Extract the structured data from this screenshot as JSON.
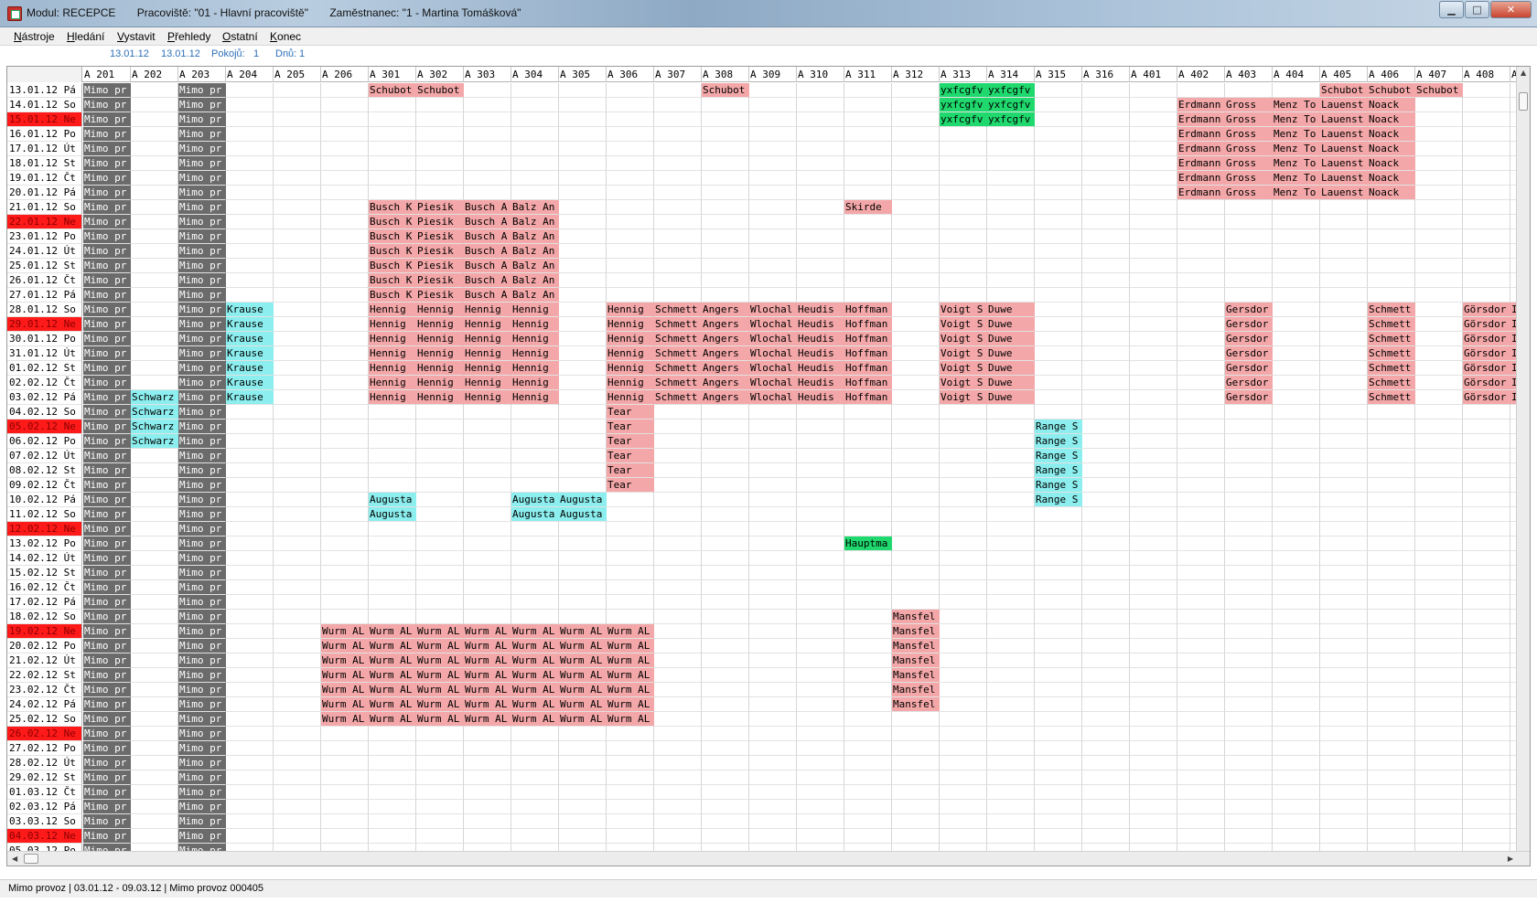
{
  "window": {
    "module": "Modul: RECEPCE",
    "workplace": "Pracoviště: \"01 - Hlavní pracoviště\"",
    "employee": "Zaměstnanec: \"1 - Martina Tomášková\"",
    "min_glyph": "▁",
    "max_glyph": "□",
    "close_glyph": "✕"
  },
  "menu": [
    {
      "hot": "N",
      "rest": "ástroje"
    },
    {
      "hot": "H",
      "rest": "ledání"
    },
    {
      "hot": "V",
      "rest": "ystavit"
    },
    {
      "hot": "P",
      "rest": "řehledy"
    },
    {
      "hot": "O",
      "rest": "statní"
    },
    {
      "hot": "K",
      "rest": "onec"
    }
  ],
  "info": {
    "date_from": "13.01.12",
    "date_to": "13.01.12",
    "rooms_label": "Pokojů:",
    "rooms_value": "1",
    "days_label": "Dnů:",
    "days_value": "1"
  },
  "colors": {
    "out_of_service": "#6b6b6b",
    "reservation": "#f4a7a8",
    "arrival": "#8ceeee",
    "confirmed": "#1fd96e",
    "sunday": "#ff1a1a"
  },
  "rooms": [
    "A 201",
    "A 202",
    "A 203",
    "A 204",
    "A 205",
    "A 206",
    "A 301",
    "A 302",
    "A 303",
    "A 304",
    "A 305",
    "A 306",
    "A 307",
    "A 308",
    "A 309",
    "A 310",
    "A 311",
    "A 312",
    "A 313",
    "A 314",
    "A 315",
    "A 316",
    "A 401",
    "A 402",
    "A 403",
    "A 404",
    "A 405",
    "A 406",
    "A 407",
    "A 408",
    "A "
  ],
  "dates": [
    {
      "label": "13.01.12 Pá"
    },
    {
      "label": "14.01.12 So"
    },
    {
      "label": "15.01.12 Ne",
      "sunday": true
    },
    {
      "label": "16.01.12 Po"
    },
    {
      "label": "17.01.12 Út"
    },
    {
      "label": "18.01.12 St"
    },
    {
      "label": "19.01.12 Čt"
    },
    {
      "label": "20.01.12 Pá"
    },
    {
      "label": "21.01.12 So"
    },
    {
      "label": "22.01.12 Ne",
      "sunday": true
    },
    {
      "label": "23.01.12 Po"
    },
    {
      "label": "24.01.12 Út"
    },
    {
      "label": "25.01.12 St"
    },
    {
      "label": "26.01.12 Čt"
    },
    {
      "label": "27.01.12 Pá"
    },
    {
      "label": "28.01.12 So"
    },
    {
      "label": "29.01.12 Ne",
      "sunday": true
    },
    {
      "label": "30.01.12 Po"
    },
    {
      "label": "31.01.12 Út"
    },
    {
      "label": "01.02.12 St"
    },
    {
      "label": "02.02.12 Čt"
    },
    {
      "label": "03.02.12 Pá"
    },
    {
      "label": "04.02.12 So"
    },
    {
      "label": "05.02.12 Ne",
      "sunday": true
    },
    {
      "label": "06.02.12 Po"
    },
    {
      "label": "07.02.12 Út"
    },
    {
      "label": "08.02.12 St"
    },
    {
      "label": "09.02.12 Čt"
    },
    {
      "label": "10.02.12 Pá"
    },
    {
      "label": "11.02.12 So"
    },
    {
      "label": "12.02.12 Ne",
      "sunday": true
    },
    {
      "label": "13.02.12 Po"
    },
    {
      "label": "14.02.12 Út"
    },
    {
      "label": "15.02.12 St"
    },
    {
      "label": "16.02.12 Čt"
    },
    {
      "label": "17.02.12 Pá"
    },
    {
      "label": "18.02.12 So"
    },
    {
      "label": "19.02.12 Ne",
      "sunday": true
    },
    {
      "label": "20.02.12 Po"
    },
    {
      "label": "21.02.12 Út"
    },
    {
      "label": "22.02.12 St"
    },
    {
      "label": "23.02.12 Čt"
    },
    {
      "label": "24.02.12 Pá"
    },
    {
      "label": "25.02.12 So"
    },
    {
      "label": "26.02.12 Ne",
      "sunday": true
    },
    {
      "label": "27.02.12 Po"
    },
    {
      "label": "28.02.12 Út"
    },
    {
      "label": "29.02.12 St"
    },
    {
      "label": "01.03.12 Čt"
    },
    {
      "label": "02.03.12 Pá"
    },
    {
      "label": "03.03.12 So"
    },
    {
      "label": "04.03.12 Ne",
      "sunday": true
    },
    {
      "label": "05.03.12 Po"
    }
  ],
  "bookings": [
    {
      "room": 0,
      "from": 0,
      "to": 52,
      "text": "Mimo pr",
      "kind": "oos"
    },
    {
      "room": 2,
      "from": 0,
      "to": 52,
      "text": "Mimo pr",
      "kind": "oos"
    },
    {
      "room": 6,
      "from": 0,
      "to": 0,
      "text": "Schubot",
      "kind": "pink"
    },
    {
      "room": 7,
      "from": 0,
      "to": 0,
      "text": "Schubot",
      "kind": "pink"
    },
    {
      "room": 13,
      "from": 0,
      "to": 0,
      "text": "Schubot",
      "kind": "pink"
    },
    {
      "room": 18,
      "from": 0,
      "to": 2,
      "text": "yxfcgfv",
      "kind": "green"
    },
    {
      "room": 19,
      "from": 0,
      "to": 2,
      "text": "yxfcgfv",
      "kind": "green"
    },
    {
      "room": 26,
      "from": 0,
      "to": 0,
      "text": "Schubot",
      "kind": "pink"
    },
    {
      "room": 27,
      "from": 0,
      "to": 0,
      "text": "Schubot",
      "kind": "pink"
    },
    {
      "room": 28,
      "from": 0,
      "to": 0,
      "text": "Schubot",
      "kind": "pink"
    },
    {
      "room": 23,
      "from": 1,
      "to": 7,
      "text": "Erdmann",
      "kind": "pink"
    },
    {
      "room": 24,
      "from": 1,
      "to": 7,
      "text": "Gross",
      "kind": "pink"
    },
    {
      "room": 25,
      "from": 1,
      "to": 7,
      "text": "Menz To",
      "kind": "pink"
    },
    {
      "room": 26,
      "from": 1,
      "to": 7,
      "text": "Lauenst",
      "kind": "pink"
    },
    {
      "room": 27,
      "from": 1,
      "to": 7,
      "text": "Noack",
      "kind": "pink"
    },
    {
      "room": 6,
      "from": 8,
      "to": 14,
      "text": "Busch K",
      "kind": "pink"
    },
    {
      "room": 7,
      "from": 8,
      "to": 14,
      "text": "Piesik",
      "kind": "pink"
    },
    {
      "room": 8,
      "from": 8,
      "to": 14,
      "text": "Busch A",
      "kind": "pink"
    },
    {
      "room": 9,
      "from": 8,
      "to": 14,
      "text": "Balz An",
      "kind": "pink"
    },
    {
      "room": 16,
      "from": 8,
      "to": 8,
      "text": "Skirde",
      "kind": "pink"
    },
    {
      "room": 3,
      "from": 15,
      "to": 21,
      "text": "Krause",
      "kind": "cyan"
    },
    {
      "room": 6,
      "from": 15,
      "to": 21,
      "text": "Hennig",
      "kind": "pink"
    },
    {
      "room": 7,
      "from": 15,
      "to": 21,
      "text": "Hennig",
      "kind": "pink"
    },
    {
      "room": 8,
      "from": 15,
      "to": 21,
      "text": "Hennig",
      "kind": "pink"
    },
    {
      "room": 9,
      "from": 15,
      "to": 21,
      "text": "Hennig",
      "kind": "pink"
    },
    {
      "room": 11,
      "from": 15,
      "to": 21,
      "text": "Hennig",
      "kind": "pink"
    },
    {
      "room": 12,
      "from": 15,
      "to": 21,
      "text": "Schmett",
      "kind": "pink"
    },
    {
      "room": 13,
      "from": 15,
      "to": 21,
      "text": "Angers",
      "kind": "pink"
    },
    {
      "room": 14,
      "from": 15,
      "to": 21,
      "text": "Wlochal",
      "kind": "pink"
    },
    {
      "room": 15,
      "from": 15,
      "to": 21,
      "text": "Heudis",
      "kind": "pink"
    },
    {
      "room": 16,
      "from": 15,
      "to": 21,
      "text": "Hoffman",
      "kind": "pink"
    },
    {
      "room": 18,
      "from": 15,
      "to": 21,
      "text": "Voigt S",
      "kind": "pink"
    },
    {
      "room": 19,
      "from": 15,
      "to": 21,
      "text": "Duwe",
      "kind": "pink"
    },
    {
      "room": 24,
      "from": 15,
      "to": 21,
      "text": "Gersdor",
      "kind": "pink"
    },
    {
      "room": 27,
      "from": 15,
      "to": 21,
      "text": "Schmett",
      "kind": "pink"
    },
    {
      "room": 29,
      "from": 15,
      "to": 21,
      "text": "Görsdor",
      "kind": "pink"
    },
    {
      "room": 30,
      "from": 15,
      "to": 21,
      "text": "I",
      "kind": "pink"
    },
    {
      "room": 1,
      "from": 21,
      "to": 24,
      "text": "Schwarz",
      "kind": "cyan"
    },
    {
      "room": 11,
      "from": 22,
      "to": 27,
      "text": "Tear",
      "kind": "pink"
    },
    {
      "room": 20,
      "from": 23,
      "to": 28,
      "text": "Range S",
      "kind": "cyan"
    },
    {
      "room": 6,
      "from": 28,
      "to": 29,
      "text": "Augusta",
      "kind": "cyan"
    },
    {
      "room": 9,
      "from": 28,
      "to": 29,
      "text": "Augusta",
      "kind": "cyan"
    },
    {
      "room": 10,
      "from": 28,
      "to": 29,
      "text": "Augusta",
      "kind": "cyan"
    },
    {
      "room": 16,
      "from": 31,
      "to": 31,
      "text": "Hauptma",
      "kind": "green"
    },
    {
      "room": 17,
      "from": 36,
      "to": 42,
      "text": "Mansfel",
      "kind": "pink"
    },
    {
      "room": 5,
      "from": 37,
      "to": 43,
      "text": "Wurm AL",
      "kind": "pink"
    },
    {
      "room": 6,
      "from": 37,
      "to": 43,
      "text": "Wurm AL",
      "kind": "pink"
    },
    {
      "room": 7,
      "from": 37,
      "to": 43,
      "text": "Wurm AL",
      "kind": "pink"
    },
    {
      "room": 8,
      "from": 37,
      "to": 43,
      "text": "Wurm AL",
      "kind": "pink"
    },
    {
      "room": 9,
      "from": 37,
      "to": 43,
      "text": "Wurm AL",
      "kind": "pink"
    },
    {
      "room": 10,
      "from": 37,
      "to": 43,
      "text": "Wurm AL",
      "kind": "pink"
    },
    {
      "room": 11,
      "from": 37,
      "to": 43,
      "text": "Wurm AL",
      "kind": "pink"
    }
  ],
  "status": {
    "text": "Mimo provoz | 03.01.12 - 09.03.12 | Mimo provoz 000405"
  }
}
